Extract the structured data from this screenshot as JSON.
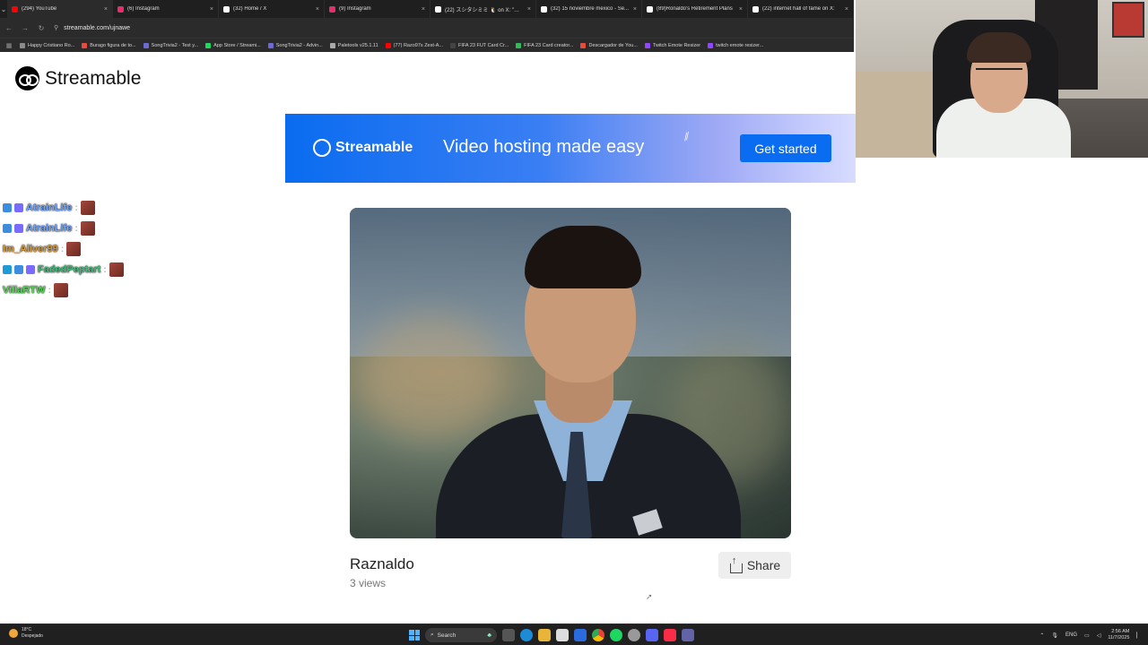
{
  "browser": {
    "tabs": [
      {
        "title": "(294) YouTube",
        "color": "#ff0000"
      },
      {
        "title": "(6) Instagram",
        "color": "#e1306c"
      },
      {
        "title": "(32) Home / X",
        "color": "#ffffff"
      },
      {
        "title": "(9) Instagram",
        "color": "#e1306c"
      },
      {
        "title": "(22) スシタシミミ 🐧 on X: \"@...",
        "color": "#ffffff"
      },
      {
        "title": "(32) 15 noviembre mexico - Se...",
        "color": "#ffffff"
      },
      {
        "title": "(89)Ronaldo's Retirement Plans",
        "color": "#ffffff"
      },
      {
        "title": "(22) internet hall of fame on X:",
        "color": "#ffffff"
      }
    ],
    "url": "streamable.com/ujnawe",
    "bookmarks": [
      {
        "label": "Happy Cristiano Ro...",
        "color": "#8a8a8a"
      },
      {
        "label": "Burago figura de to...",
        "color": "#e84b3c"
      },
      {
        "label": "SongTrivia2 - Test y...",
        "color": "#6b6bd6"
      },
      {
        "label": "App Store / Streami...",
        "color": "#1ed760"
      },
      {
        "label": "SongTrivia2 - Advin...",
        "color": "#6b6bd6"
      },
      {
        "label": "Paletools v25.1.11",
        "color": "#aaaaaa"
      },
      {
        "label": "(77) Razo97s Zest-A...",
        "color": "#ff0000"
      },
      {
        "label": "FIFA 23 FUT Card Cr...",
        "color": "#444444"
      },
      {
        "label": "FIFA 23 Card creator...",
        "color": "#2ebd59"
      },
      {
        "label": "Descargador de You...",
        "color": "#e84b3c"
      },
      {
        "label": "Twitch Emote Resizer",
        "color": "#9146ff"
      },
      {
        "label": "twitch emote resizer...",
        "color": "#9146ff"
      }
    ]
  },
  "site": {
    "brand": "Streamable"
  },
  "banner": {
    "brand": "Streamable",
    "tagline": "Video hosting made easy",
    "cta": "Get started"
  },
  "video": {
    "title": "Raznaldo",
    "views": "3 views",
    "share_label": "Share"
  },
  "chat": [
    {
      "user": "AtrainLife",
      "color": "#6ea5ff",
      "badges": [
        "#3c8de0",
        "#7a6bff"
      ]
    },
    {
      "user": "AtrainLife",
      "color": "#6ea5ff",
      "badges": [
        "#3c8de0",
        "#7a6bff"
      ]
    },
    {
      "user": "Im_Aliver99",
      "color": "#d89a3a",
      "badges": []
    },
    {
      "user": "FadedPeptart",
      "color": "#3fbf7a",
      "badges": [
        "#1e9bd6",
        "#3c8de0",
        "#7a6bff"
      ]
    },
    {
      "user": "VillaRTW",
      "color": "#5cd65c",
      "badges": []
    }
  ],
  "taskbar": {
    "temp": "18°C",
    "weather_desc": "Despejado",
    "search": "Search",
    "lang": "ENG",
    "time": "2:56 AM",
    "date": "11/7/2025"
  }
}
